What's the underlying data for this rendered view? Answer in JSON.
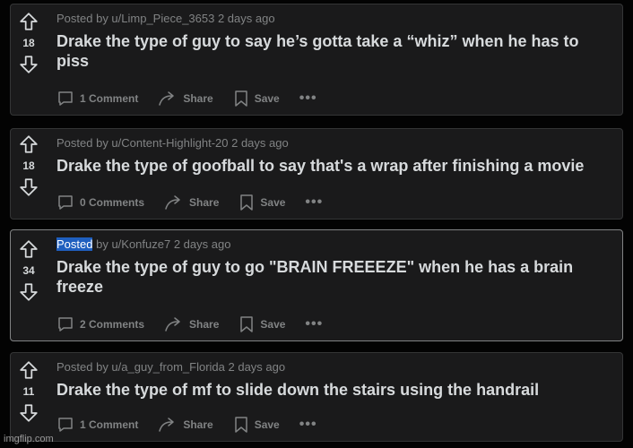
{
  "posts": [
    {
      "posted_by": "Posted by u/Limp_Piece_3653 2 days ago",
      "score": "18",
      "title": "Drake the type of guy to say he’s gotta take a “whiz” when he has to piss",
      "comments": "1 Comment",
      "share": "Share",
      "save": "Save",
      "more": "•••"
    },
    {
      "posted_by": "Posted by u/Content-Highlight-20 2 days ago",
      "score": "18",
      "title": "Drake the type of goofball to say that's a wrap after finishing a movie",
      "comments": "0 Comments",
      "share": "Share",
      "save": "Save",
      "more": "•••"
    },
    {
      "posted_word": "Posted",
      "posted_rest": " by u/Konfuze7 2 days ago",
      "score": "34",
      "title": "Drake the type of guy to go \"BRAIN FREEEZE\" when he has a brain freeze",
      "comments": "2 Comments",
      "share": "Share",
      "save": "Save",
      "more": "•••"
    },
    {
      "posted_by": "Posted by u/a_guy_from_Florida 2 days ago",
      "score": "11",
      "title": "Drake the type of mf to slide down the stairs using the handrail",
      "comments": "1 Comment",
      "share": "Share",
      "save": "Save",
      "more": "•••"
    }
  ],
  "watermark": "imgflip.com",
  "colors": {
    "background": "#030303",
    "card": "#1a1a1b",
    "border": "#343536",
    "text": "#d7dadc",
    "muted": "#818384",
    "selection": "#1f5fbf"
  },
  "icons": [
    "upvote-arrow-icon",
    "downvote-arrow-icon",
    "comment-bubble-icon",
    "share-arrow-icon",
    "bookmark-icon"
  ]
}
